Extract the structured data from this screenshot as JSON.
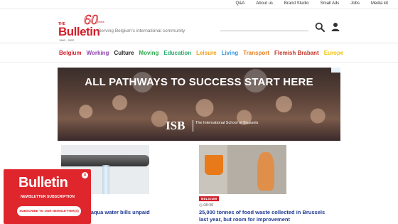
{
  "topbar": {
    "links": [
      "Q&A",
      "About us",
      "Brand Studio",
      "Small Ads",
      "Jobs",
      "Media kit"
    ]
  },
  "header": {
    "logo": {
      "the": "THE",
      "name": "Bulletin",
      "anniversary": "60",
      "years": "years",
      "dates": "1962 - 2022"
    },
    "tagline": "Serving Belgium's international community"
  },
  "nav": {
    "categories": [
      {
        "label": "Belgium",
        "color": "#d11f2a"
      },
      {
        "label": "Working",
        "color": "#8e44ad"
      },
      {
        "label": "Culture",
        "color": "#222222"
      },
      {
        "label": "Moving",
        "color": "#2ea84a"
      },
      {
        "label": "Education",
        "color": "#27a86b"
      },
      {
        "label": "Leisure",
        "color": "#f39c12"
      },
      {
        "label": "Living",
        "color": "#3498db"
      },
      {
        "label": "Transport",
        "color": "#e67e22"
      },
      {
        "label": "Flemish Brabant",
        "color": "#c0392b"
      },
      {
        "label": "Europe",
        "color": "#f1c40f"
      }
    ]
  },
  "banner_ad": {
    "headline": "ALL PATHWAYS TO SUCCESS START HERE",
    "logo_abbr": "ISB",
    "school_name": "The International School of Brussels"
  },
  "articles": [
    {
      "title": "n Vivaqua water bills unpaid"
    },
    {
      "tag": "BELGIUM",
      "time": "08:39",
      "title": "25,000 tonnes of food waste collected in Brussels last year, but room for improvement"
    }
  ],
  "newsletter_popup": {
    "the": "THE",
    "logo": "Bulletin",
    "subtitle": "NEWSLETTER SUBSCRIPTION",
    "button": "SUBSCRIBE TO OUR NEWSLETTER(S)",
    "close_symbol": "×"
  },
  "colors": {
    "brand_red": "#d11f2a",
    "link_blue": "#1f3a93"
  }
}
